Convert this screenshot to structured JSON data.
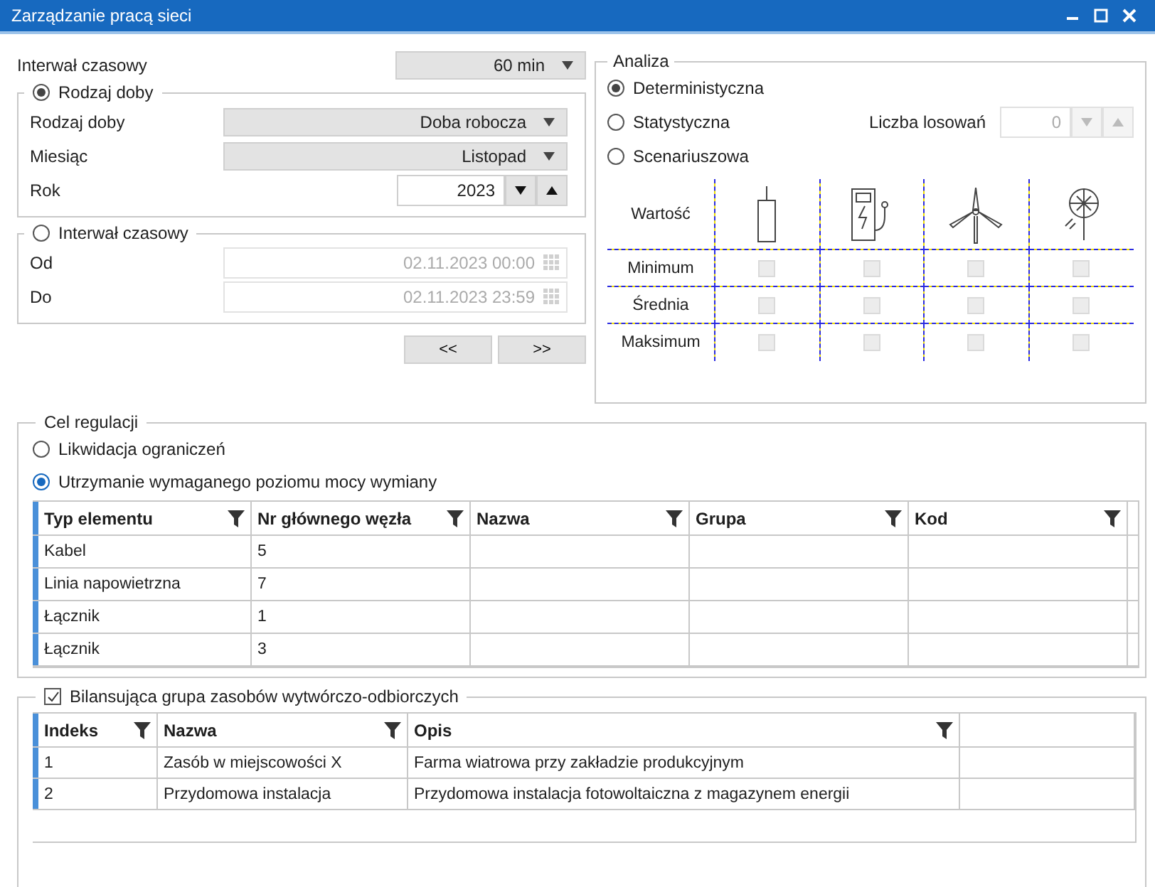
{
  "window": {
    "title": "Zarządzanie pracą sieci"
  },
  "interval": {
    "label": "Interwał czasowy",
    "value": "60 min"
  },
  "day_type_group": {
    "label": "Rodzaj doby",
    "selected": true,
    "fields": [
      {
        "kind": "dropdown",
        "label": "Rodzaj doby",
        "value": "Doba robocza"
      },
      {
        "kind": "dropdown",
        "label": "Miesiąc",
        "value": "Listopad"
      },
      {
        "kind": "spinner",
        "label": "Rok",
        "value": "2023"
      }
    ]
  },
  "interval_group": {
    "label": "Interwał czasowy",
    "selected": false,
    "fields": [
      {
        "label": "Od",
        "value": "02.11.2023 00:00",
        "disabled": true
      },
      {
        "label": "Do",
        "value": "02.11.2023 23:59",
        "disabled": true
      }
    ]
  },
  "nav_buttons": [
    "<<",
    ">>"
  ],
  "analysis": {
    "title": "Analiza",
    "modes": [
      {
        "label": "Deterministyczna",
        "selected": true
      },
      {
        "label": "Statystyczna",
        "selected": false
      },
      {
        "label": "Scenariuszowa",
        "selected": false
      }
    ],
    "draws": {
      "label": "Liczba losowań",
      "value": "0",
      "disabled": true
    },
    "value_label": "Wartość",
    "columns": [
      {
        "kind": "cabinet"
      },
      {
        "kind": "charger"
      },
      {
        "kind": "turbine"
      },
      {
        "kind": "solar"
      }
    ],
    "rows": [
      {
        "label": "Minimum",
        "checks": [
          {
            "checked": false,
            "disabled": true
          },
          {
            "checked": false,
            "disabled": true
          },
          {
            "checked": false,
            "disabled": true
          },
          {
            "checked": false,
            "disabled": true
          }
        ]
      },
      {
        "label": "Średnia",
        "checks": [
          {
            "checked": false,
            "disabled": true
          },
          {
            "checked": false,
            "disabled": true
          },
          {
            "checked": false,
            "disabled": true
          },
          {
            "checked": false,
            "disabled": true
          }
        ]
      },
      {
        "label": "Maksimum",
        "checks": [
          {
            "checked": false,
            "disabled": true
          },
          {
            "checked": false,
            "disabled": true
          },
          {
            "checked": false,
            "disabled": true
          },
          {
            "checked": false,
            "disabled": true
          }
        ]
      }
    ]
  },
  "regulation": {
    "title": "Cel regulacji",
    "options": [
      {
        "label": "Likwidacja ograniczeń",
        "selected": false
      },
      {
        "label": "Utrzymanie wymaganego poziomu mocy wymiany",
        "selected": true
      }
    ],
    "table": {
      "columns": [
        "Typ elementu",
        "Nr głównego węzła",
        "Nazwa",
        "Grupa",
        "Kod"
      ],
      "rows": [
        {
          "cells": [
            "Kabel",
            "5"
          ]
        },
        {
          "cells": [
            "Linia napowietrzna",
            "7"
          ]
        },
        {
          "cells": [
            "Łącznik",
            "1"
          ]
        },
        {
          "cells": [
            "Łącznik",
            "3"
          ]
        }
      ]
    }
  },
  "balancing": {
    "title": "Bilansująca grupa zasobów wytwórczo-odbiorczych",
    "checked": true,
    "table": {
      "columns": [
        "Indeks",
        "Nazwa",
        "Opis"
      ],
      "rows": [
        {
          "cells": [
            "1",
            "Zasób w miejscowości X",
            "Farma wiatrowa przy zakładzie produkcyjnym"
          ]
        },
        {
          "cells": [
            "2",
            "Przydomowa instalacja",
            "Przydomowa instalacja fotowoltaiczna z magazynem energii"
          ]
        }
      ]
    }
  }
}
